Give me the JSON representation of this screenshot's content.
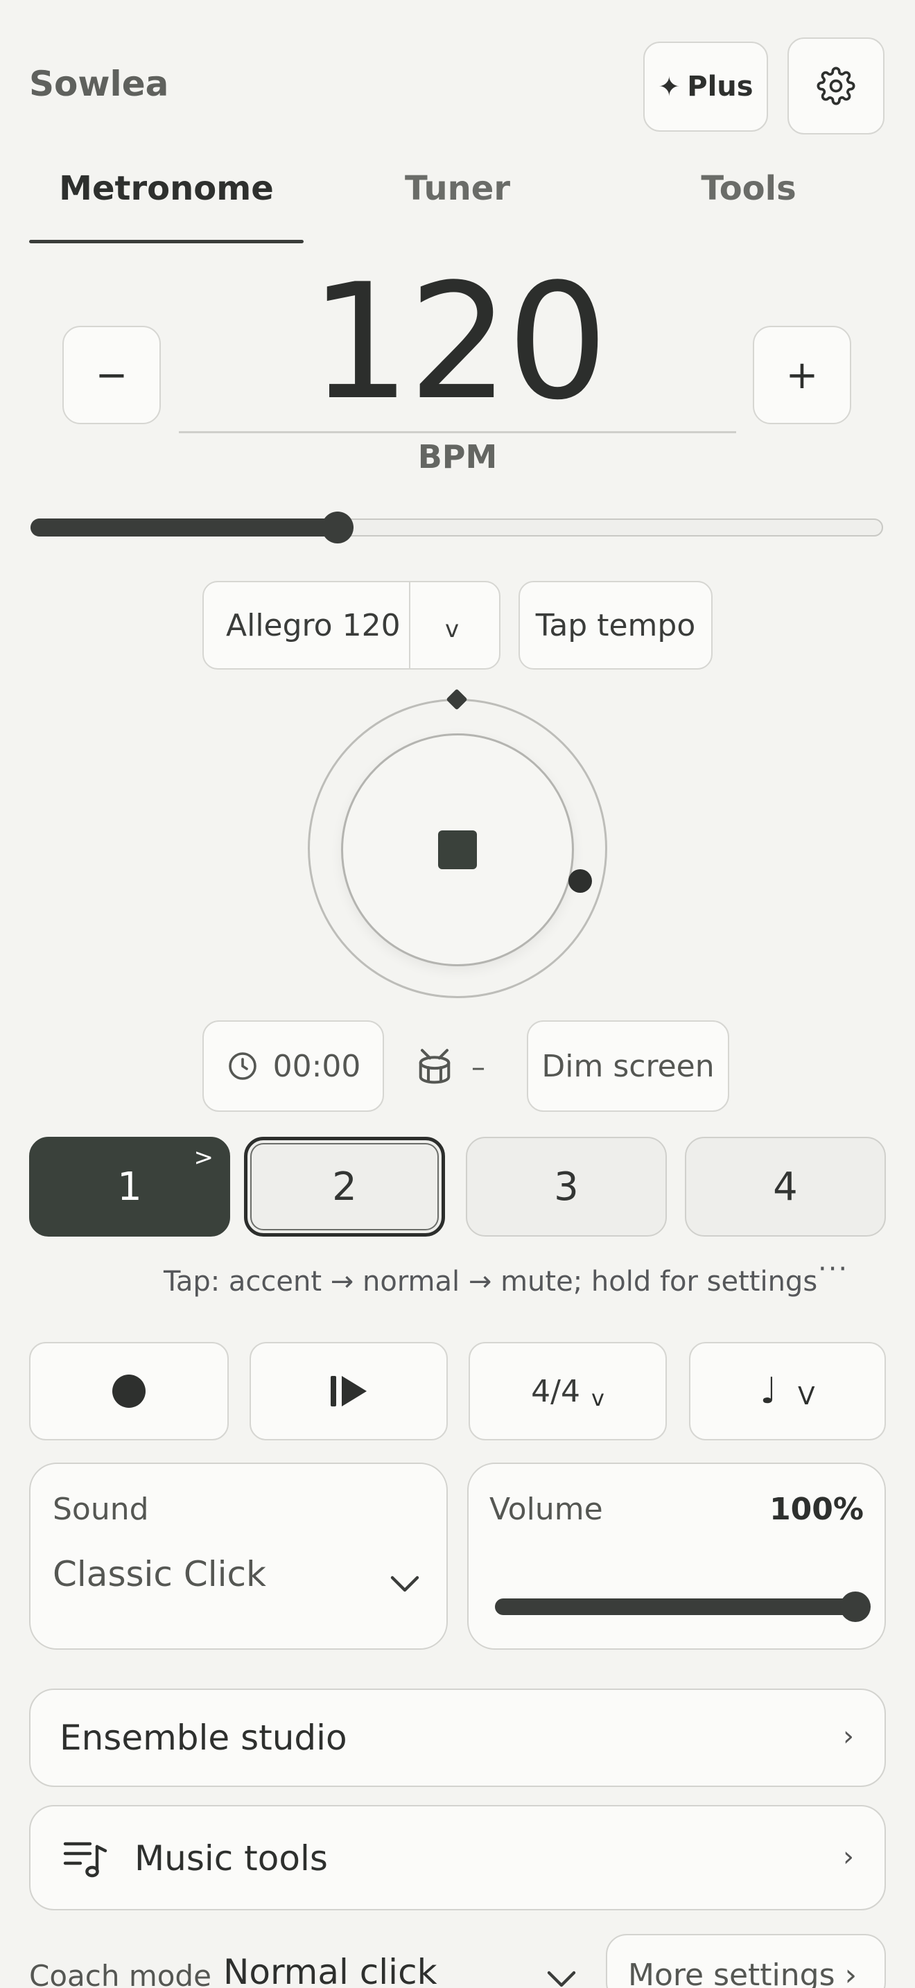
{
  "header": {
    "app_title": "Sowlea",
    "plus_label": "Plus"
  },
  "tabs": [
    {
      "label": "Metronome",
      "active": true
    },
    {
      "label": "Tuner",
      "active": false
    },
    {
      "label": "Tools",
      "active": false
    }
  ],
  "tempo": {
    "bpm": "120",
    "unit": "BPM",
    "minus": "−",
    "plus": "+",
    "slider_fraction": 0.36
  },
  "preset": {
    "selected": "Allegro 120",
    "dropdown": "v",
    "tap_tempo": "Tap tempo"
  },
  "transport": {
    "timer": "00:00",
    "drum_value": "–",
    "dim_screen": "Dim screen"
  },
  "beats": [
    {
      "label": "1",
      "accent_mark": ">",
      "state": "accent"
    },
    {
      "label": "2",
      "state": "selected"
    },
    {
      "label": "3",
      "state": "normal"
    },
    {
      "label": "4",
      "state": "normal"
    }
  ],
  "beat_hint": "Tap: accent → normal → mute; hold for settings",
  "more_dots": "···",
  "controls": {
    "time_signature": "4/4",
    "time_signature_caret": "v",
    "subdivision_note": "♩",
    "subdivision_caret": "V"
  },
  "sound": {
    "label": "Sound",
    "value": "Classic Click"
  },
  "volume": {
    "label": "Volume",
    "value": "100%",
    "fraction": 1.0
  },
  "ensemble": {
    "label": "Ensemble studio",
    "chevron": "›"
  },
  "music_tools": {
    "label": "Music tools",
    "chevron": "›"
  },
  "coach": {
    "label": "Coach mode",
    "value": "Normal click",
    "more_settings": "More settings ›"
  },
  "colors": {
    "background": "#f4f4f1",
    "accent_dark": "#3a413b",
    "text": "#2e302e"
  }
}
